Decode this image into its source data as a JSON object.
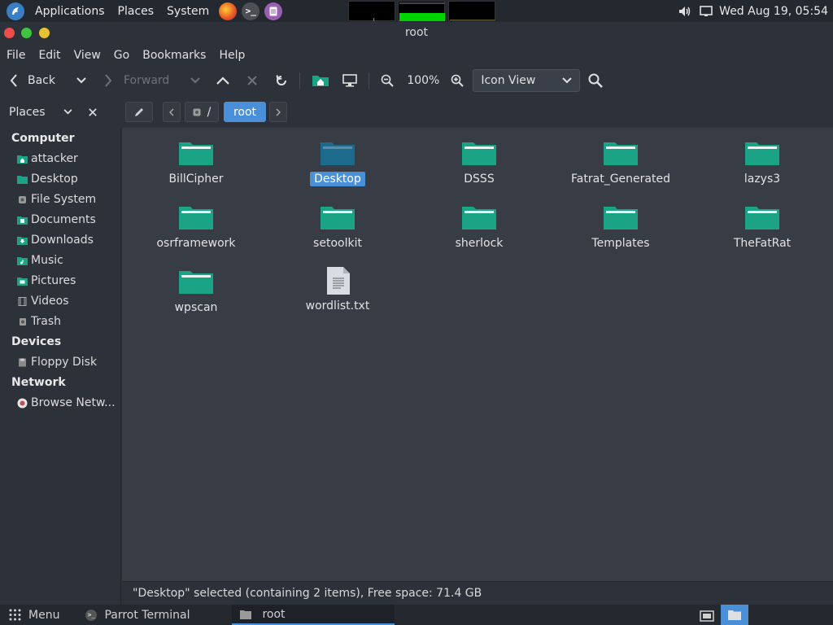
{
  "top_panel": {
    "menus": [
      "Applications",
      "Places",
      "System"
    ],
    "clock": "Wed Aug 19, 05:54"
  },
  "window": {
    "title": "root"
  },
  "menubar": {
    "items": [
      "File",
      "Edit",
      "View",
      "Go",
      "Bookmarks",
      "Help"
    ]
  },
  "toolbar": {
    "back_label": "Back",
    "forward_label": "Forward",
    "zoom": "100%",
    "view_mode": "Icon View"
  },
  "pathbar": {
    "places_label": "Places",
    "root_crumb": "/",
    "current_crumb": "root"
  },
  "sidebar": {
    "sections": [
      {
        "title": "Computer",
        "items": [
          "attacker",
          "Desktop",
          "File System",
          "Documents",
          "Downloads",
          "Music",
          "Pictures",
          "Videos",
          "Trash"
        ]
      },
      {
        "title": "Devices",
        "items": [
          "Floppy Disk"
        ]
      },
      {
        "title": "Network",
        "items": [
          "Browse Netw..."
        ]
      }
    ]
  },
  "files": [
    {
      "name": "BillCipher",
      "type": "folder"
    },
    {
      "name": "Desktop",
      "type": "folder",
      "selected": true
    },
    {
      "name": "DSSS",
      "type": "folder"
    },
    {
      "name": "Fatrat_Generated",
      "type": "folder"
    },
    {
      "name": "lazys3",
      "type": "folder"
    },
    {
      "name": "osrframework",
      "type": "folder"
    },
    {
      "name": "setoolkit",
      "type": "folder"
    },
    {
      "name": "sherlock",
      "type": "folder"
    },
    {
      "name": "Templates",
      "type": "folder"
    },
    {
      "name": "TheFatRat",
      "type": "folder"
    },
    {
      "name": "wpscan",
      "type": "folder"
    },
    {
      "name": "wordlist.txt",
      "type": "text-file"
    }
  ],
  "statusbar": {
    "text": "\"Desktop\" selected (containing 2 items), Free space: 71.4 GB"
  },
  "bottom_panel": {
    "menu_label": "Menu",
    "tasks": [
      "Parrot Terminal",
      "root"
    ]
  },
  "colors": {
    "folder": "#1aa384",
    "folder_selected": "#1c6a8c",
    "selection": "#4a90d9"
  }
}
